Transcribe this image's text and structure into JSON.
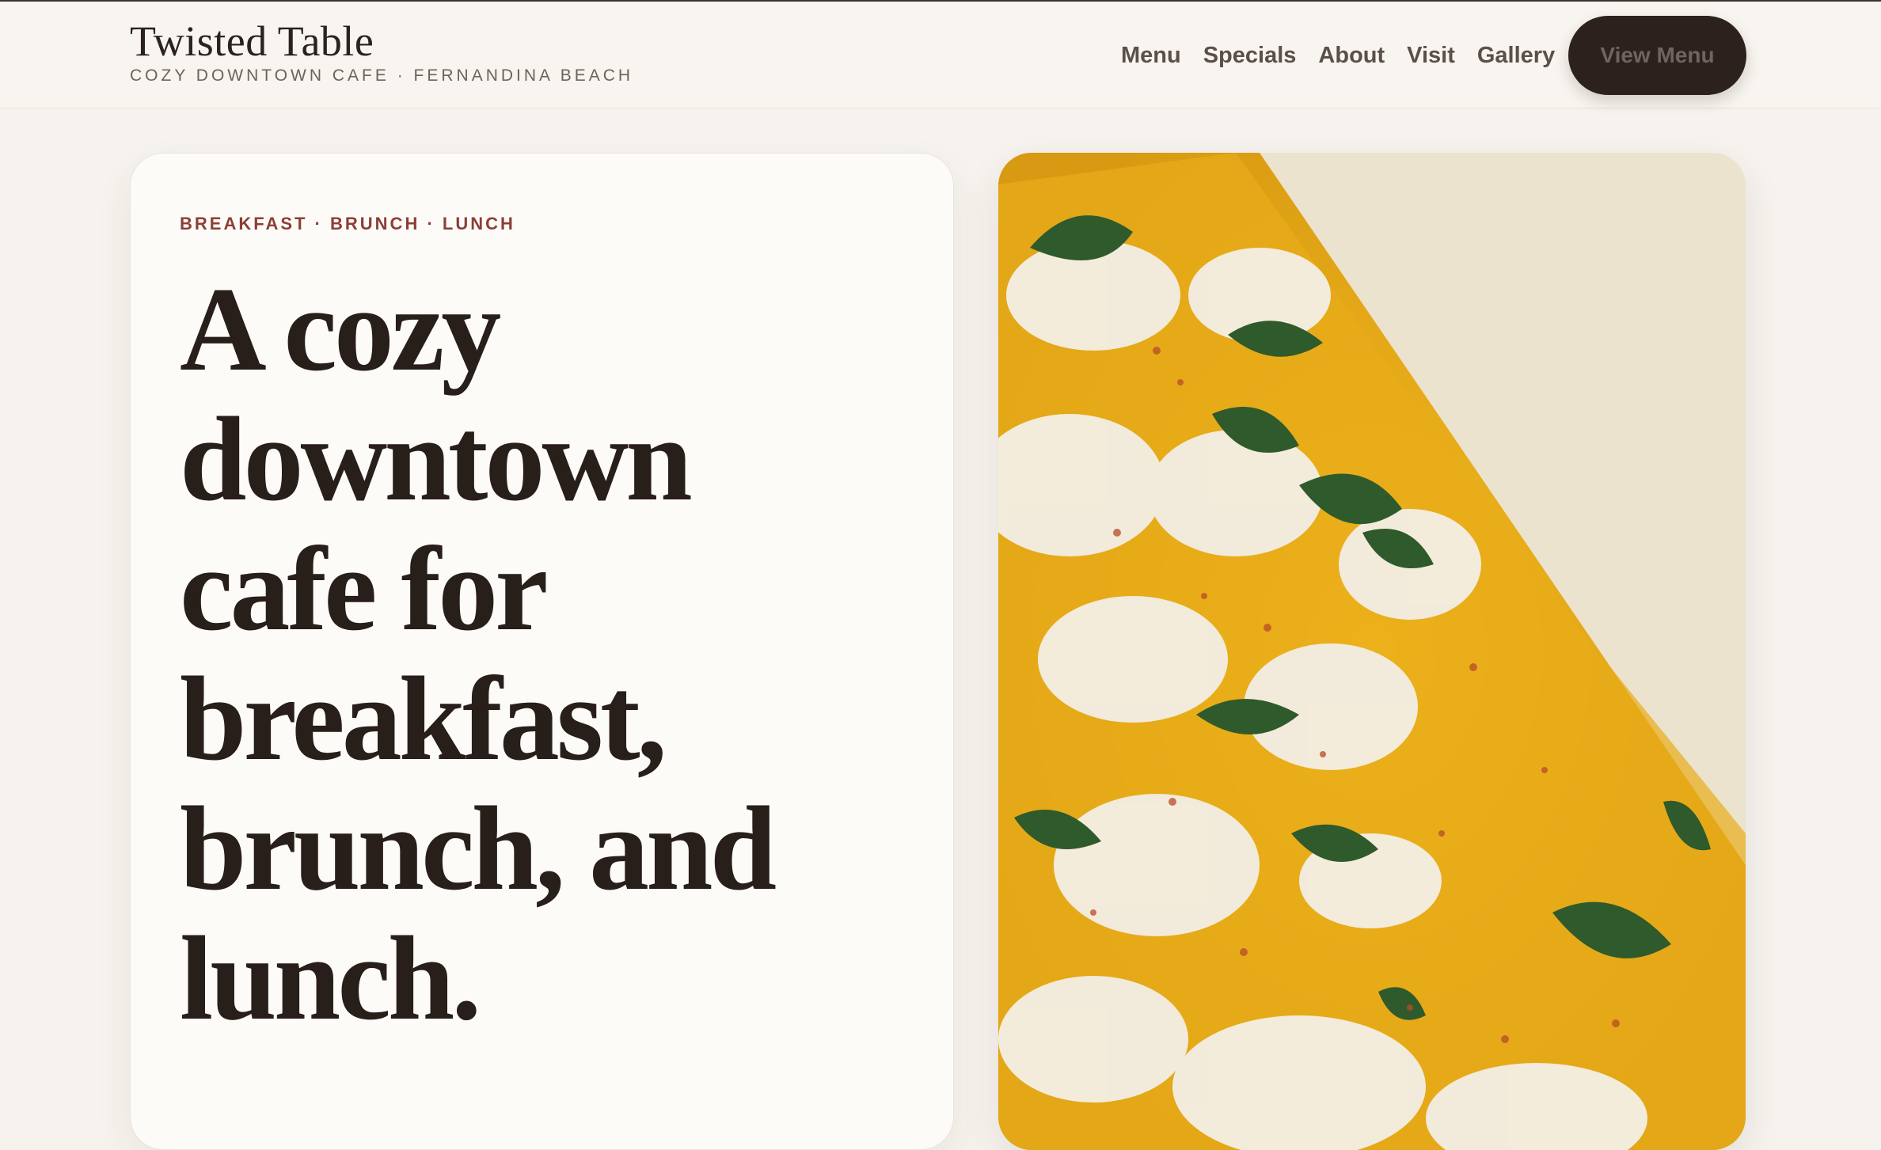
{
  "header": {
    "brand_name": "Twisted Table",
    "brand_tagline": "COZY DOWNTOWN CAFE · FERNANDINA BEACH",
    "nav": [
      {
        "label": "Menu"
      },
      {
        "label": "Specials"
      },
      {
        "label": "About"
      },
      {
        "label": "Visit"
      },
      {
        "label": "Gallery"
      }
    ],
    "cta_label": "View Menu"
  },
  "hero": {
    "kicker": "BREAKFAST · BRUNCH · LUNCH",
    "headline": "A cozy downtown cafe for breakfast, brunch, and lunch."
  },
  "colors": {
    "background": "#f6f2ed",
    "accent": "#8b3f35",
    "button": "#2d211e",
    "text": "#281e1a"
  }
}
